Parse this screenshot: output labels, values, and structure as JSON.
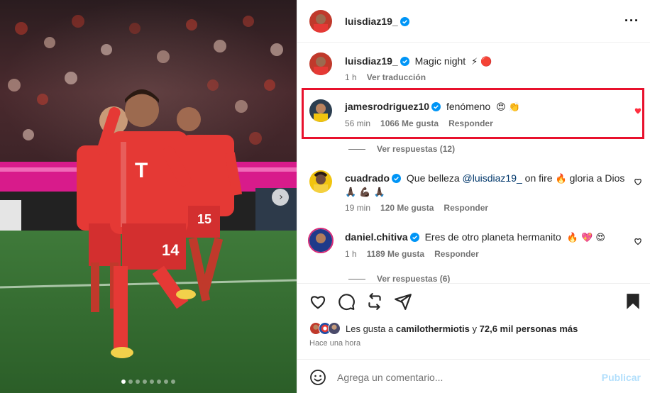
{
  "post": {
    "author": "luisdiaz19_",
    "caption_author": "luisdiaz19_",
    "caption": "Magic night",
    "caption_emojis": "⚡ 🔴",
    "caption_time": "1 h",
    "translate_label": "Ver traducción",
    "slide_count": 8,
    "active_slide": 1
  },
  "comments": [
    {
      "username": "jamesrodriguez10",
      "text": "fenómeno",
      "emojis": "😍 👏",
      "time": "56 min",
      "likes": "1066 Me gusta",
      "reply_label": "Responder",
      "liked": true,
      "replies_label": "Ver respuestas (12)"
    },
    {
      "username": "cuadrado",
      "text_before": "Que belleza",
      "mention": "@luisdiaz19_",
      "text_after": "on fire",
      "emojis1": "🔥",
      "text_after2": "gloria a Dios",
      "emojis2": "🙏🏿 💪🏿 🙏🏿",
      "time": "19 min",
      "likes": "120 Me gusta",
      "reply_label": "Responder",
      "liked": false
    },
    {
      "username": "daniel.chitiva",
      "text": "Eres de otro planeta hermanito",
      "emojis": "🔥 💖 😍",
      "time": "1 h",
      "likes": "1189 Me gusta",
      "reply_label": "Responder",
      "liked": false,
      "replies_label": "Ver respuestas (6)"
    }
  ],
  "likes_summary": {
    "prefix": "Les gusta a",
    "user": "camilothermiotis",
    "connector": "y",
    "others": "72,6 mil personas más"
  },
  "posted_ago": "Hace una hora",
  "composer": {
    "placeholder": "Agrega un comentario...",
    "publish_label": "Publicar"
  },
  "colors": {
    "highlight": "#e8112d",
    "heart_liked": "#ff3040",
    "verified": "#0095f6",
    "publish_disabled": "#b2dffc"
  },
  "icons": [
    "more-options-icon",
    "verified-badge-icon",
    "like-icon",
    "comment-icon",
    "share-icon",
    "send-icon",
    "bookmark-icon",
    "emoji-icon",
    "carousel-next-icon"
  ]
}
